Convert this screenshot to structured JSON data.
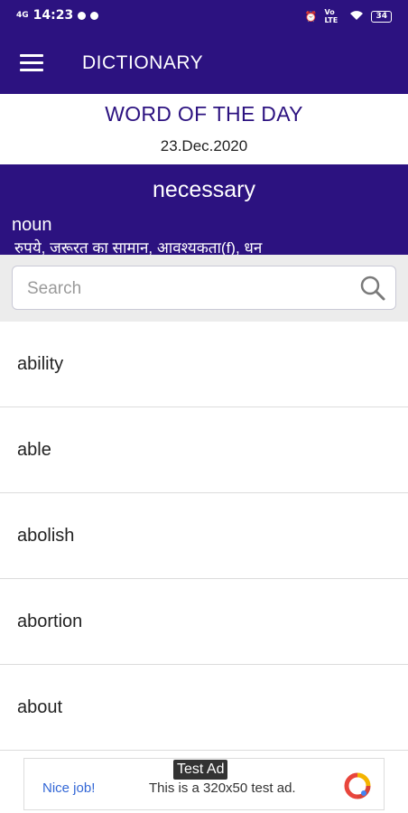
{
  "status_bar": {
    "left_text": "4G",
    "time": "14:23",
    "network": "Vo LTE",
    "battery": "34"
  },
  "app_bar": {
    "title": "DICTIONARY"
  },
  "word_of_day": {
    "heading": "WORD OF THE DAY",
    "date": "23.Dec.2020",
    "word": "necessary",
    "part_of_speech": "noun",
    "meaning": "रुपये, जरूरत का सामान, आवश्यकता(f), धन"
  },
  "search": {
    "placeholder": "Search",
    "value": ""
  },
  "word_list": [
    {
      "label": "ability"
    },
    {
      "label": "able"
    },
    {
      "label": "abolish"
    },
    {
      "label": "abortion"
    },
    {
      "label": "about"
    }
  ],
  "ad": {
    "badge": "Test Ad",
    "nice": "Nice job!",
    "text": "This is a 320x50 test ad."
  },
  "colors": {
    "primary": "#2c1280",
    "accent_blue": "#3367d6"
  }
}
